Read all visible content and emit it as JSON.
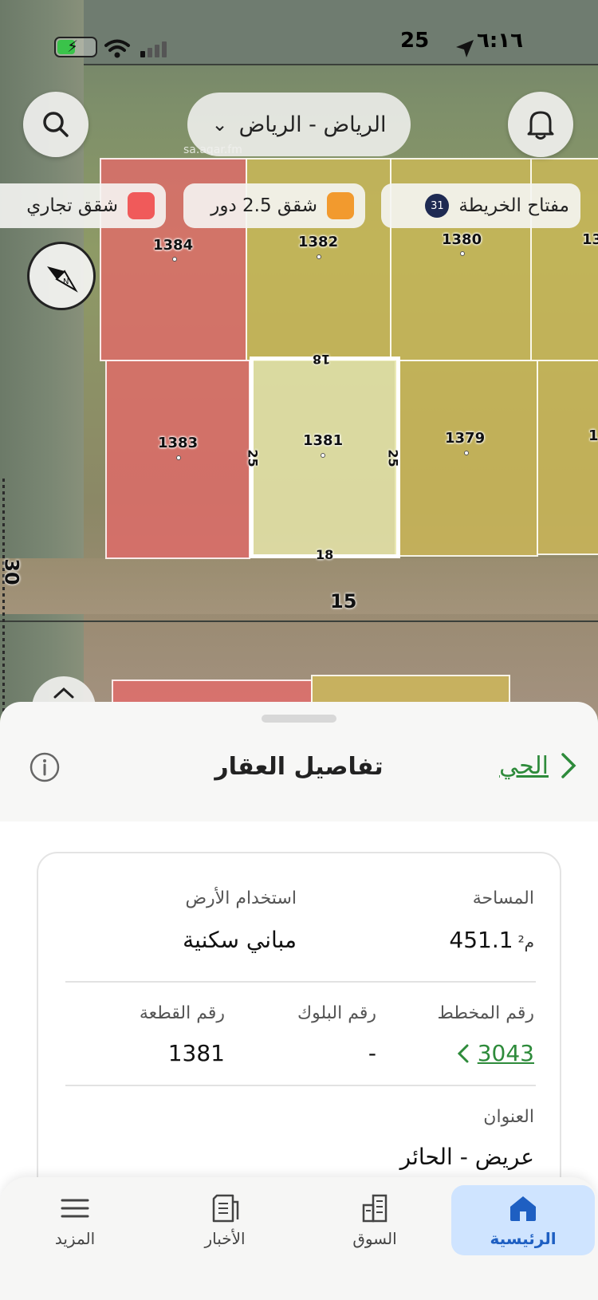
{
  "status_bar": {
    "time": "٦:١٦",
    "signal_num": "25"
  },
  "top_bar": {
    "city": "الرياض - الرياض"
  },
  "legend": {
    "map_key_label": "مفتاح الخريطة",
    "map_key_count": "31",
    "items": [
      {
        "label": "شقق 2.5 دور",
        "color": "#f29a2e"
      },
      {
        "label": "شقق تجاري",
        "color": "#f05a5a"
      }
    ]
  },
  "map": {
    "plots": [
      "1384",
      "1382",
      "1380",
      "1383",
      "1381",
      "1379",
      "13",
      "1"
    ],
    "dims": {
      "top": "18",
      "bottom": "18",
      "left": "25",
      "right": "25"
    },
    "streets": {
      "h": "15",
      "v": "30"
    },
    "watermark": "sa.aqar.fm"
  },
  "sheet": {
    "title": "تفاصيل العقار",
    "neighborhood_link": "الحي",
    "area_label": "المساحة",
    "area_value": "451.1",
    "area_unit": "م²",
    "land_use_label": "استخدام الأرض",
    "land_use_value": "مباني سكنية",
    "plan_label": "رقم المخطط",
    "plan_value": "3043",
    "block_label": "رقم البلوك",
    "block_value": "-",
    "plot_label": "رقم القطعة",
    "plot_value": "1381",
    "address_label": "العنوان",
    "address_value": "عريض - الحائر"
  },
  "tabs": [
    {
      "label": "الرئيسية",
      "icon": "home-icon"
    },
    {
      "label": "السوق",
      "icon": "building-icon"
    },
    {
      "label": "الأخبار",
      "icon": "news-icon"
    },
    {
      "label": "المزيد",
      "icon": "menu-icon"
    }
  ],
  "colors": {
    "accent_green": "#2e8b3b",
    "tab_active_bg": "#cfe4ff",
    "tab_active_text": "#1e5fc2"
  }
}
